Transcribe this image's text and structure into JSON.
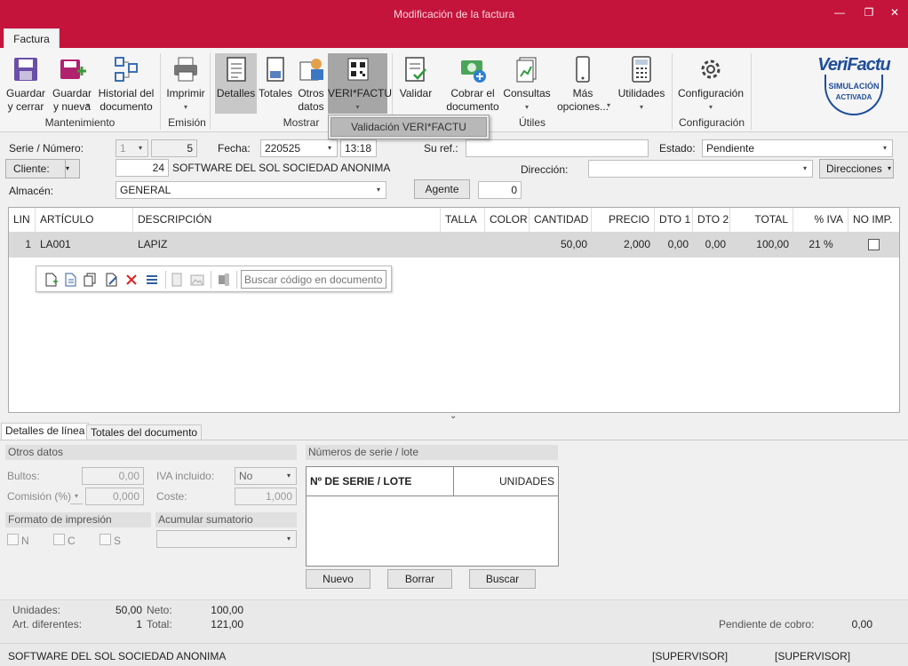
{
  "window": {
    "title": "Modificación de la factura",
    "tab": "Factura"
  },
  "ribbon": {
    "buttons": {
      "guardar_cerrar": "Guardar\ny cerrar",
      "guardar_nueva": "Guardar\ny nueva",
      "historial": "Historial del\ndocumento",
      "imprimir": "Imprimir",
      "detalles": "Detalles",
      "totales": "Totales",
      "otros_datos": "Otros\ndatos",
      "verifactu": "VERI*FACTU",
      "validar": "Validar",
      "cobrar": "Cobrar el\ndocumento",
      "consultas": "Consultas",
      "mas_opciones": "Más\nopciones...",
      "utilidades": "Utilidades",
      "configuracion": "Configuración"
    },
    "groups": {
      "mantenimiento": "Mantenimiento",
      "emision": "Emisión",
      "mostrar": "Mostrar",
      "utiles": "Útiles",
      "configuracion": "Configuración"
    },
    "dropdown_item": "Validación VERI*FACTU",
    "logo": {
      "brand": "VeriFactu",
      "line1": "SIMULACIÓN",
      "line2": "ACTIVADA"
    }
  },
  "header": {
    "serie_label": "Serie / Número:",
    "serie": "1",
    "numero": "5",
    "fecha_label": "Fecha:",
    "fecha": "220525",
    "hora": "13:18",
    "suref_label": "Su ref.:",
    "suref": "",
    "estado_label": "Estado:",
    "estado": "Pendiente",
    "cliente_label": "Cliente:",
    "cliente_code": "24",
    "cliente_name": "SOFTWARE DEL SOL SOCIEDAD ANONIMA",
    "direccion_label": "Dirección:",
    "direccion": "",
    "direcciones_btn": "Direcciones",
    "almacen_label": "Almacén:",
    "almacen": "GENERAL",
    "agente_btn": "Agente",
    "agente": "0"
  },
  "grid": {
    "columns": [
      "LIN",
      "ARTÍCULO",
      "DESCRIPCIÓN",
      "TALLA",
      "COLOR",
      "CANTIDAD",
      "PRECIO",
      "DTO 1",
      "DTO 2",
      "TOTAL",
      "% IVA",
      "NO IMP."
    ],
    "rows": [
      {
        "lin": "1",
        "articulo": "LA001",
        "descripcion": "LAPIZ",
        "talla": "",
        "color": "",
        "cantidad": "50,00",
        "precio": "2,000",
        "dto1": "0,00",
        "dto2": "0,00",
        "total": "100,00",
        "iva": "21 %",
        "noimp": false
      }
    ],
    "search_placeholder": "Buscar código en documento"
  },
  "bottom_tabs": [
    "Detalles de línea",
    "Totales del documento"
  ],
  "detalles": {
    "otros_datos": "Otros datos",
    "bultos_label": "Bultos:",
    "bultos": "0,00",
    "iva_incluido_label": "IVA incluido:",
    "iva_incluido": "No",
    "comision_label": "Comisión (%)",
    "comision": "0,000",
    "coste_label": "Coste:",
    "coste": "1,000",
    "formato_label": "Formato de impresión",
    "formato_options": [
      "N",
      "C",
      "S"
    ],
    "acumular_label": "Acumular sumatorio",
    "lotes_label": "Números de serie / lote",
    "lotes_col1": "Nº DE SERIE / LOTE",
    "lotes_col2": "UNIDADES",
    "btn_nuevo": "Nuevo",
    "btn_borrar": "Borrar",
    "btn_buscar": "Buscar"
  },
  "footer": {
    "unidades_label": "Unidades:",
    "unidades": "50,00",
    "art_label": "Art. diferentes:",
    "art": "1",
    "neto_label": "Neto:",
    "neto": "100,00",
    "total_label": "Total:",
    "total": "121,00",
    "pendiente_label": "Pendiente de cobro:",
    "pendiente": "0,00",
    "company": "SOFTWARE DEL SOL SOCIEDAD ANONIMA",
    "user1": "[SUPERVISOR]",
    "user2": "[SUPERVISOR]"
  },
  "colors": {
    "accent": "#c4143c",
    "logo_blue": "#1f4e9a",
    "logo_green": "#8bbf2a"
  }
}
